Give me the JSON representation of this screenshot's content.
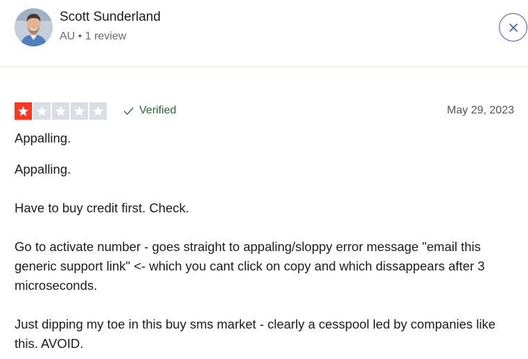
{
  "reviewer": {
    "name": "Scott Sunderland",
    "meta": "AU • 1 review"
  },
  "review": {
    "rating": 1,
    "max_rating": 5,
    "verified_label": "Verified",
    "date": "May 29, 2023",
    "title": "Appalling.",
    "paragraphs": [
      "Appalling.",
      "Have to buy credit first. Check.",
      "Go to activate number - goes straight to appaling/sloppy error message \"email this generic support link\" <- which you cant click on copy and which dissappears after 3 microseconds.",
      "Just dipping my toe in this buy sms market - clearly a cesspool led by companies like this. AVOID."
    ]
  },
  "icons": {
    "close": "close-icon",
    "verified": "checkmark-icon",
    "star": "star-icon"
  },
  "colors": {
    "star_filled": "#ff3722",
    "star_empty": "#dcdce6",
    "verified": "#1c6f2e",
    "close_button": "#3b59d8"
  }
}
